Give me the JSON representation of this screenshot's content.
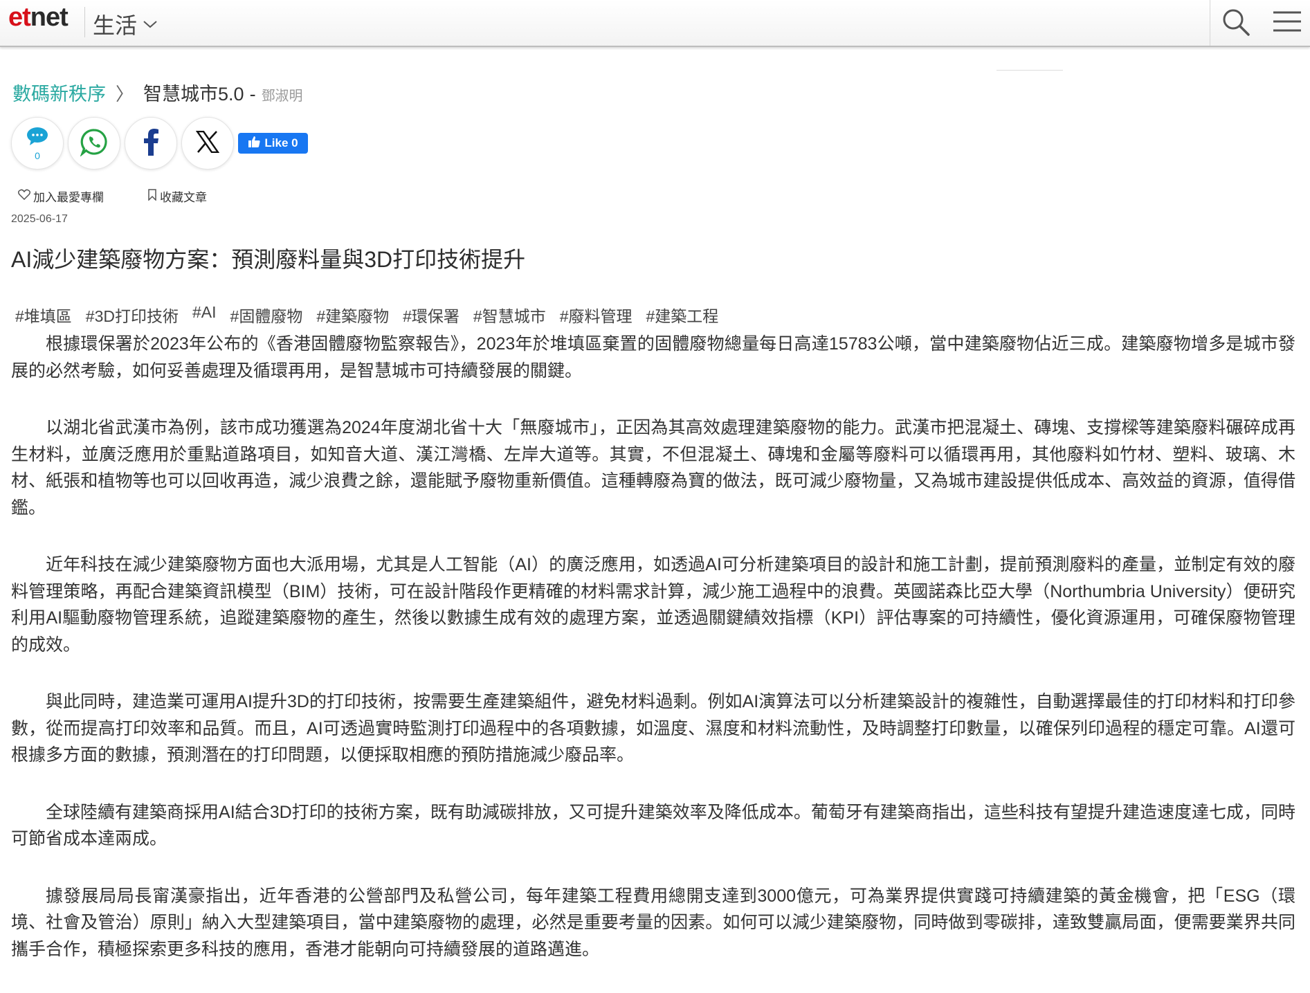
{
  "header": {
    "logo_e": "et",
    "logo_net": "net",
    "section": "生活",
    "colors": {
      "logo_red": "#d7101a",
      "breadcrumb_teal": "#2aa9a1",
      "fb_blue": "#1877f2"
    }
  },
  "breadcrumb": {
    "column": "數碼新秩序",
    "arrow": "〉",
    "subcolumn": "智慧城市5.0",
    "dash": "-",
    "author": "鄧淑明"
  },
  "share": {
    "comment_count": "0",
    "like_label": "Like 0"
  },
  "actions": {
    "add_fav": "加入最愛專欄",
    "save_article": "收藏文章"
  },
  "article": {
    "date": "2025-06-17",
    "title": "AI減少建築廢物方案：預測廢料量與3D打印技術提升",
    "tags": [
      "#堆填區",
      "#3D打印技術",
      "#AI",
      "#固體廢物",
      "#建築廢物",
      "#環保署",
      "#智慧城市",
      "#廢料管理",
      "#建築工程"
    ],
    "paragraphs": [
      "根據環保署於2023年公布的《香港固體廢物監察報告》，2023年於堆填區棄置的固體廢物總量每日高達15783公噸，當中建築廢物佔近三成。建築廢物增多是城市發展的必然考驗，如何妥善處理及循環再用，是智慧城市可持續發展的關鍵。",
      "以湖北省武漢市為例，該市成功獲選為2024年度湖北省十大「無廢城市」，正因為其高效處理建築廢物的能力。武漢市把混凝土、磚塊、支撐樑等建築廢料碾碎成再生材料，並廣泛應用於重點道路項目，如知音大道、漢江灣橋、左岸大道等。其實，不但混凝土、磚塊和金屬等廢料可以循環再用，其他廢料如竹材、塑料、玻璃、木材、紙張和植物等也可以回收再造，減少浪費之餘，還能賦予廢物重新價值。這種轉廢為寶的做法，既可減少廢物量，又為城市建設提供低成本、高效益的資源，值得借鑑。",
      "近年科技在減少建築廢物方面也大派用場，尤其是人工智能（AI）的廣泛應用，如透過AI可分析建築項目的設計和施工計劃，提前預測廢料的產量，並制定有效的廢料管理策略，再配合建築資訊模型（BIM）技術，可在設計階段作更精確的材料需求計算，減少施工過程中的浪費。英國諾森比亞大學（Northumbria University）便研究利用AI驅動廢物管理系統，追蹤建築廢物的產生，然後以數據生成有效的處理方案，並透過關鍵績效指標（KPI）評估專案的可持續性，優化資源運用，可確保廢物管理的成效。",
      "與此同時，建造業可運用AI提升3D的打印技術，按需要生產建築組件，避免材料過剩。例如AI演算法可以分析建築設計的複雜性，自動選擇最佳的打印材料和打印參數，從而提高打印效率和品質。而且，AI可透過實時監測打印過程中的各項數據，如溫度、濕度和材料流動性，及時調整打印數量，以確保列印過程的穩定可靠。AI還可根據多方面的數據，預測潛在的打印問題，以便採取相應的預防措施減少廢品率。",
      "全球陸續有建築商採用AI結合3D打印的技術方案，既有助減碳排放，又可提升建築效率及降低成本。葡萄牙有建築商指出，這些科技有望提升建造速度達七成，同時可節省成本達兩成。",
      "據發展局局長甯漢豪指出，近年香港的公營部門及私營公司，每年建築工程費用總開支達到3000億元，可為業界提供實踐可持續建築的黃金機會，把「ESG（環境、社會及管治）原則」納入大型建築項目，當中建築廢物的處理，必然是重要考量的因素。如何可以減少建築廢物，同時做到零碳排，達致雙贏局面，便需要業界共同攜手合作，積極探索更多科技的應用，香港才能朝向可持續發展的道路邁進。"
    ]
  }
}
